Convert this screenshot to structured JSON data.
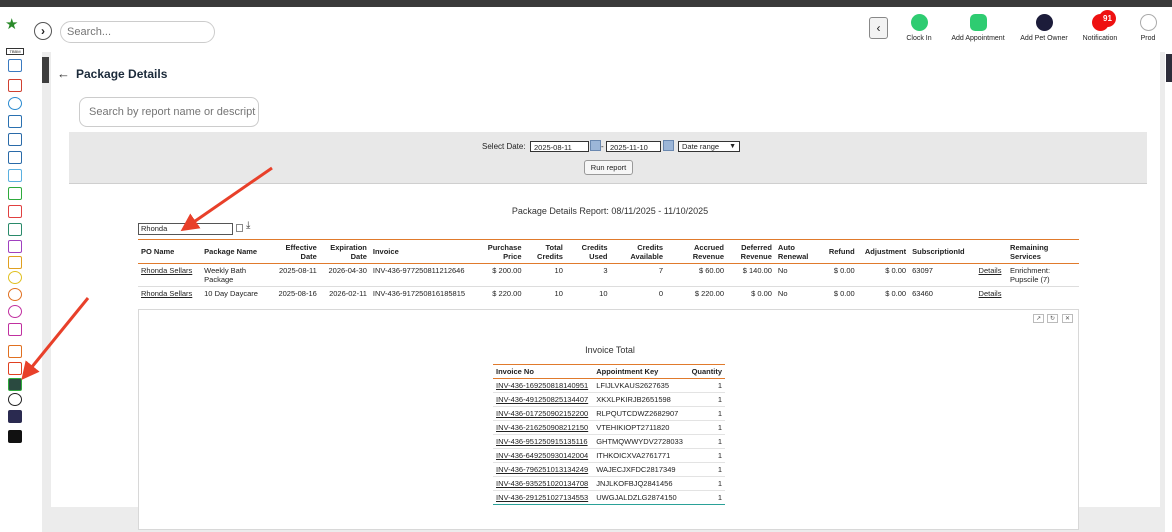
{
  "top": {
    "search_placeholder": "Search...",
    "nav": [
      {
        "label": "Clock In",
        "icon": "clock-icon",
        "color": "#2ecc71"
      },
      {
        "label": "Add Appointment",
        "icon": "calendar-add-icon",
        "color": "#2ecc71"
      },
      {
        "label": "Add Pet Owner",
        "icon": "user-add-icon",
        "color": "#1c1c3a"
      },
      {
        "label": "Notification",
        "icon": "bell-icon",
        "color": "#e11"
      },
      {
        "label": "Prod",
        "icon": "profile-icon",
        "color": "#aaa"
      }
    ],
    "notification_count": "91"
  },
  "page": {
    "title": "Package Details",
    "report_search_placeholder": "Search by report name or description"
  },
  "filters": {
    "select_date_label": "Select Date:",
    "start_date": "2025-08-11",
    "separator": "-",
    "end_date": "2025-11-10",
    "range_option": "Date range",
    "run_label": "Run report"
  },
  "report": {
    "title": "Package Details Report: 08/11/2025 - 11/10/2025",
    "po_filter_value": "Rhonda",
    "columns": [
      "PO Name",
      "Package Name",
      "Effective Date",
      "Expiration Date",
      "Invoice",
      "Purchase Price",
      "Total Credits",
      "Credits Used",
      "Credits Available",
      "Accrued Revenue",
      "Deferred Revenue",
      "Auto Renewal",
      "Refund",
      "Adjustment",
      "SubscriptionId",
      "",
      "Remaining Services"
    ],
    "rows": [
      {
        "po_name": "Rhonda Sellars",
        "package": "Weekly Bath Package",
        "effective": "2025-08-11",
        "expiration": "2026-04-30",
        "invoice": "INV-436-977250811212646",
        "price": "$ 200.00",
        "total_credits": "10",
        "used": "3",
        "available": "7",
        "accrued": "$ 60.00",
        "deferred": "$ 140.00",
        "auto_renewal": "No",
        "refund": "$ 0.00",
        "adjustment": "$ 0.00",
        "subscription_id": "63097",
        "details": "Details",
        "remaining": "Enrichment: Pupscile (7)"
      },
      {
        "po_name": "Rhonda Sellars",
        "package": "10 Day Daycare",
        "effective": "2025-08-16",
        "expiration": "2026-02-11",
        "invoice": "INV-436-917250816185815",
        "price": "$ 220.00",
        "total_credits": "10",
        "used": "10",
        "available": "0",
        "accrued": "$ 220.00",
        "deferred": "$ 0.00",
        "auto_renewal": "No",
        "refund": "$ 0.00",
        "adjustment": "$ 0.00",
        "subscription_id": "63460",
        "details": "Details",
        "remaining": ""
      }
    ]
  },
  "invoice_total": {
    "title": "Invoice Total",
    "columns": [
      "Invoice No",
      "Appointment Key",
      "Quantity"
    ],
    "rows": [
      {
        "invoice": "INV-436-169250818140951",
        "key": "LFIJLVKAUS2627635",
        "qty": "1"
      },
      {
        "invoice": "INV-436-491250825134407",
        "key": "XKXLPKIRJB2651598",
        "qty": "1"
      },
      {
        "invoice": "INV-436-017250902152200",
        "key": "RLPQUTCDWZ2682907",
        "qty": "1"
      },
      {
        "invoice": "INV-436-216250908212150",
        "key": "VTEHIKIOPT2711820",
        "qty": "1"
      },
      {
        "invoice": "INV-436-951250915135116",
        "key": "GHTMQWWYDV2728033",
        "qty": "1"
      },
      {
        "invoice": "INV-436-649250930142004",
        "key": "ITHKOICXVA2761771",
        "qty": "1"
      },
      {
        "invoice": "INV-436-796251013134249",
        "key": "WAJECJXFDC2817349",
        "qty": "1"
      },
      {
        "invoice": "INV-436-935251020134708",
        "key": "JNJLKOFBJQ2841456",
        "qty": "1"
      },
      {
        "invoice": "INV-436-291251027134553",
        "key": "UWGJALDZLG2874150",
        "qty": "1"
      }
    ]
  },
  "colors": {
    "accent_line": "#e07a2c",
    "annotation_arrow": "#e8402a",
    "sidebar_green": "#2eaa3c"
  }
}
